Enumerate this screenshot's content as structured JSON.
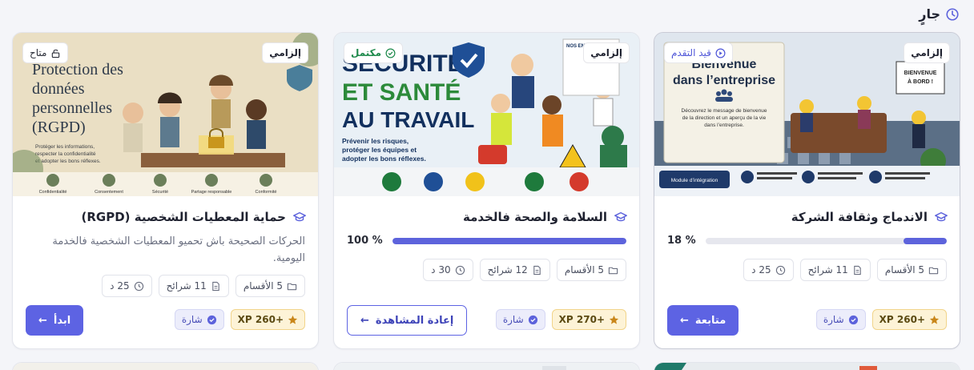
{
  "section": {
    "title": "جارٍ",
    "icon": "clock-icon"
  },
  "cards": [
    {
      "title": "الاندماج وثقافة الشركة",
      "mandatory": "إلزامي",
      "status": "قيد التقدم",
      "status_icon": "play-circle-icon",
      "progress": 18,
      "progress_label": "18 %",
      "meta": {
        "sections": "5 الأقسام",
        "slides": "11 شرائح",
        "duration": "25 د"
      },
      "xp": "+260 XP",
      "badge": "شارة",
      "button": "متابعة",
      "thumb_title": "Bienvenue dans l’entreprise",
      "thumb_sub": "Découvrez le message de bienvenue de la direction et un aperçu de la vie dans l’entreprise.",
      "thumb_sign": "BIENVENUE À BORD !"
    },
    {
      "title": "السلامة والصحة فالخدمة",
      "mandatory": "إلزامي",
      "status": "مكتمل",
      "status_icon": "check-circle-icon",
      "progress": 100,
      "progress_label": "100 %",
      "meta": {
        "sections": "5 الأقسام",
        "slides": "12 شرائح",
        "duration": "30 د"
      },
      "xp": "+270 XP",
      "badge": "شارة",
      "button": "إعادة المشاهدة",
      "thumb_title": [
        "SÉCURITÉ",
        "ET SANTÉ",
        "AU TRAVAIL"
      ],
      "thumb_sub": "Prévenir les risques, protéger les équipes et adopter les bons réflexes."
    },
    {
      "title": "حماية المعطيات الشخصية (RGPD)",
      "mandatory": "إلزامي",
      "status": "متاح",
      "status_icon": "unlock-icon",
      "description": "الحركات الصحيحة باش تحميو المعطيات الشخصية فالخدمة اليومية.",
      "meta": {
        "sections": "5 الأقسام",
        "slides": "11 شرائح",
        "duration": "25 د"
      },
      "xp": "+260 XP",
      "badge": "شارة",
      "button": "ابدأ",
      "thumb_title": [
        "Protection des",
        "données",
        "personnelles",
        "(RGPD)"
      ],
      "thumb_sub": "Protéger les informations, respecter la confidentialité et adopter les bons réflexes.",
      "thumb_footer": [
        "Confidentialité",
        "Consentement",
        "Sécurité",
        "Partage responsable",
        "Conformité"
      ]
    }
  ],
  "colors": {
    "accent": "#5d63e3",
    "xp_bg": "#fdf3d7",
    "badge_bg": "#ecedfb",
    "done": "#1e8a4c"
  }
}
